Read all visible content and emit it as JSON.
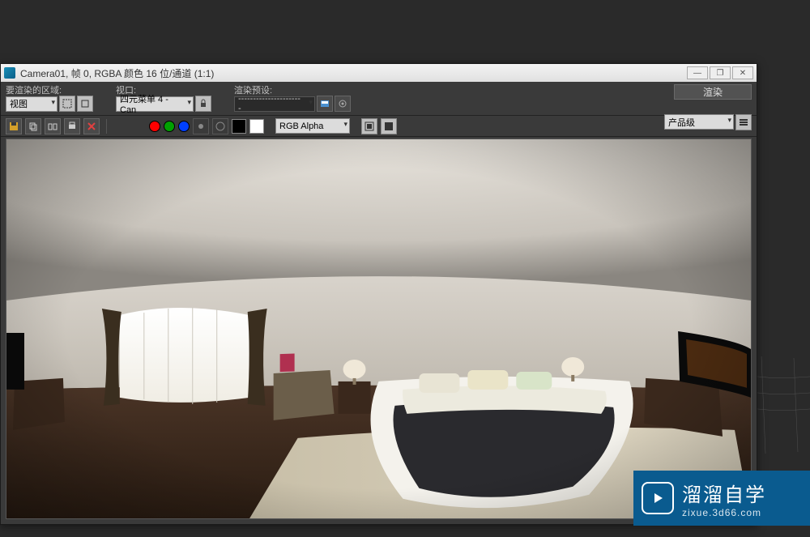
{
  "window": {
    "title": "Camera01, 帧 0, RGBA 颜色 16 位/通道 (1:1)"
  },
  "toolbar": {
    "area_label": "要渲染的区域:",
    "area_value": "视图",
    "viewport_label": "视口:",
    "viewport_value": "四元菜单 4 - Can",
    "preset_label": "渲染预设:",
    "preset_value": "----------------------",
    "render_button": "渲染",
    "product_value": "产品级"
  },
  "toolbar2": {
    "channel_value": "RGB Alpha",
    "colors": {
      "red": "#ff0000",
      "green": "#00a000",
      "blue": "#0040ff"
    }
  },
  "watermark": {
    "brand_zh": "溜溜自学",
    "brand_en": "zixue.3d66.com"
  },
  "win_controls": {
    "minimize": "—",
    "maximize": "❐",
    "close": "✕"
  }
}
